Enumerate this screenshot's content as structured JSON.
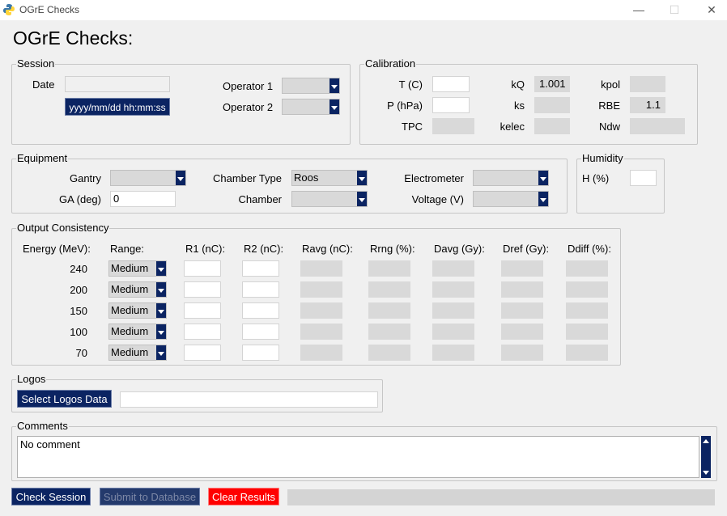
{
  "window": {
    "title": "OGrE Checks",
    "minimize": "—",
    "maximize": "☐",
    "close": "✕"
  },
  "page_title": "OGrE Checks:",
  "session": {
    "legend": "Session",
    "date_label": "Date",
    "date_value": "",
    "date_button": "yyyy/mm/dd hh:mm:ss",
    "operator1_label": "Operator 1",
    "operator2_label": "Operator 2",
    "operator1_value": "",
    "operator2_value": ""
  },
  "calibration": {
    "legend": "Calibration",
    "t_label": "T (C)",
    "p_label": "P (hPa)",
    "tpc_label": "TPC",
    "kq_label": "kQ",
    "ks_label": "ks",
    "kelec_label": "kelec",
    "kpol_label": "kpol",
    "rbe_label": "RBE",
    "ndw_label": "Ndw",
    "t_value": "",
    "p_value": "",
    "tpc_value": "",
    "kq_value": "1.001",
    "ks_value": "",
    "kelec_value": "",
    "kpol_value": "",
    "rbe_value": "1.1",
    "ndw_value": ""
  },
  "equipment": {
    "legend": "Equipment",
    "gantry_label": "Gantry",
    "gantry_value": "",
    "ga_label": "GA (deg)",
    "ga_value": "0",
    "chamber_type_label": "Chamber Type",
    "chamber_type_value": "Roos",
    "chamber_label": "Chamber",
    "chamber_value": "",
    "electrometer_label": "Electrometer",
    "electrometer_value": "",
    "voltage_label": "Voltage (V)",
    "voltage_value": ""
  },
  "humidity": {
    "legend": "Humidity",
    "h_label": "H (%)",
    "h_value": ""
  },
  "output": {
    "legend": "Output Consistency",
    "headers": [
      "Energy (MeV):",
      "Range:",
      "R1 (nC):",
      "R2 (nC):",
      "Ravg (nC):",
      "Rrng (%):",
      "Davg (Gy):",
      "Dref (Gy):",
      "Ddiff (%):"
    ],
    "rows": [
      {
        "energy": "240",
        "range": "Medium"
      },
      {
        "energy": "200",
        "range": "Medium"
      },
      {
        "energy": "150",
        "range": "Medium"
      },
      {
        "energy": "100",
        "range": "Medium"
      },
      {
        "energy": "70",
        "range": "Medium"
      }
    ]
  },
  "logos": {
    "legend": "Logos",
    "button": "Select Logos Data",
    "path_value": ""
  },
  "comments": {
    "legend": "Comments",
    "text": "No comment"
  },
  "footer": {
    "check_button": "Check Session",
    "submit_button": "Submit to Database",
    "clear_button": "Clear Results",
    "progress": 0
  },
  "colors": {
    "button_bg": "#0b2462",
    "clear_bg": "#ff0000",
    "readonly_bg": "#d9d9d9"
  }
}
